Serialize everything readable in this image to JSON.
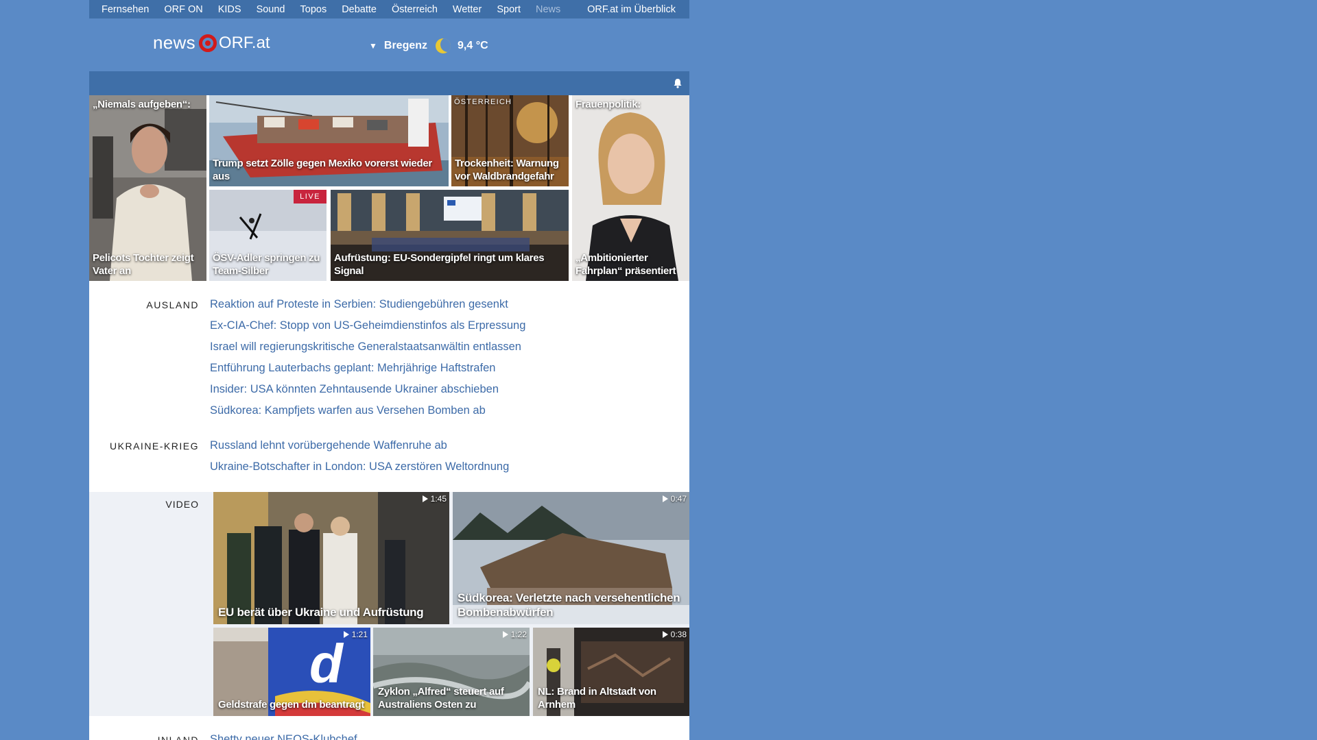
{
  "nav": {
    "items": [
      "Fernsehen",
      "ORF ON",
      "KIDS",
      "Sound",
      "Topos",
      "Debatte",
      "Österreich",
      "Wetter",
      "Sport",
      "News"
    ],
    "active": "News",
    "overview": "ORF.at im Überblick"
  },
  "header": {
    "logo_news": "news",
    "logo_orf": "ORF.at",
    "location": "Bregenz",
    "temperature": "9,4 °C",
    "weather_icon": "moon-icon"
  },
  "teasers": [
    {
      "kicker": "„Niemals aufgeben“:",
      "title": "Pelicots Tochter zeigt Vater an"
    },
    {
      "kicker": "",
      "title": "Trump setzt Zölle gegen Mexiko vorerst wieder aus"
    },
    {
      "section": "ÖSTERREICH",
      "title": "Trockenheit: Warnung vor Waldbrandgefahr"
    },
    {
      "kicker": "Frauenpolitik:",
      "title": "„Ambitionierter Fahrplan“ präsentiert"
    },
    {
      "badge": "LIVE",
      "title": "ÖSV-Adler springen zu Team-Silber"
    },
    {
      "kicker": "",
      "title": "Aufrüstung: EU-Sondergipfel ringt um klares Signal"
    }
  ],
  "ausland": {
    "label": "AUSLAND",
    "links": [
      "Reaktion auf Proteste in Serbien: Studiengebühren gesenkt",
      "Ex-CIA-Chef: Stopp von US-Geheimdienstinfos als Erpressung",
      "Israel will regierungskritische Generalstaatsanwältin entlassen",
      "Entführung Lauterbachs geplant: Mehrjährige Haftstrafen",
      "Insider: USA könnten Zehntausende Ukrainer abschieben",
      "Südkorea: Kampfjets warfen aus Versehen Bomben ab"
    ]
  },
  "ukraine": {
    "label": "UKRAINE-KRIEG",
    "links": [
      "Russland lehnt vorübergehende Waffenruhe ab",
      "Ukraine-Botschafter in London: USA zerstören Weltordnung"
    ]
  },
  "video": {
    "label": "VIDEO",
    "items": [
      {
        "title": "EU berät über Ukraine und Aufrüstung",
        "duration": "1:45"
      },
      {
        "title": "Südkorea: Verletzte nach versehentlichen Bombenabwürfen",
        "duration": "0:47"
      },
      {
        "title": "Geldstrafe gegen dm beantragt",
        "duration": "1:21"
      },
      {
        "title": "Zyklon „Alfred“ steuert auf Australiens Osten zu",
        "duration": "1:22"
      },
      {
        "title": "NL: Brand in Altstadt von Arnhem",
        "duration": "0:38"
      }
    ]
  },
  "inland": {
    "label": "INLAND",
    "first_link": "Shetty neuer NEOS-Klubchef"
  }
}
